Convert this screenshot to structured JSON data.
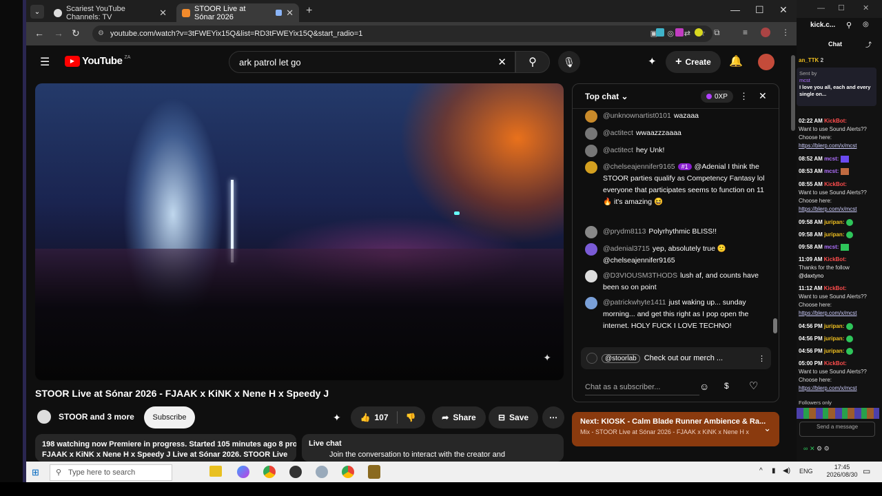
{
  "browser": {
    "tabs": [
      {
        "title": "Scariest YouTube Channels: TV",
        "favicon_color": "#e0e0e0"
      },
      {
        "title": "STOOR Live at Sónar 2026",
        "favicon_color": "#f28b2c"
      }
    ],
    "url": "youtube.com/watch?v=3tFWEYix15Q&list=RD3tFWEYix15Q&start_radio=1"
  },
  "youtube": {
    "logo": "YouTube",
    "country": "ZA",
    "search_value": "ark patrol let go",
    "create_label": "Create"
  },
  "video": {
    "title": "STOOR Live at Sónar 2026 - FJAAK x KiNK x Nene H x Speedy J",
    "channel": "STOOR and 3 more",
    "subscribe_label": "Subscribe",
    "likes": "107",
    "share_label": "Share",
    "save_label": "Save",
    "desc_line1": "198 watching now  Premiere in progress. Started 105 minutes ago  8 prod",
    "desc_line2": "FJAAK x KiNK x Nene H x Speedy J Live at Sónar 2026. STOOR Live",
    "livechat_label": "Live chat",
    "livechat_sub": "Join the conversation to interact with the creator and"
  },
  "chat": {
    "header": "Top chat",
    "xp_badge": "0XP",
    "messages": [
      {
        "user": "@unknownartist0101",
        "text": "wazaaa",
        "color": "#c98a2a"
      },
      {
        "user": "@actitect",
        "text": "wwaazzzaaaa",
        "color": "#777"
      },
      {
        "user": "@actitect",
        "text": "hey Unk!",
        "color": "#777"
      },
      {
        "user": "@chelseajennifer9165",
        "badge": "#1",
        "text": "@Adenial I think the STOOR parties qualify as Competency Fantasy lol everyone that participates seems to function on 11 🔥 it's amazing 😆",
        "color": "#d4a020"
      },
      {
        "user": "@prydm8113",
        "text": "Polyrhythmic BLISS!!",
        "color": "#888"
      },
      {
        "user": "@adenial3715",
        "text": "yep, absolutely true 🙂 @chelseajennifer9165",
        "color": "#7a5bd6"
      },
      {
        "user": "@D3VIOUSM3THODS",
        "text": "lush af, and counts have been so on point",
        "color": "#ddd"
      },
      {
        "user": "@patrickwhyte1411",
        "text": "just waking up... sunday morning... and get this right as I pop open the internet. HOLY FUCK I LOVE TECHNO!",
        "color": "#7aa0d8"
      }
    ],
    "pinned_user": "@stoorlab",
    "pinned_text": "Check out our merch ...",
    "input_placeholder": "Chat as a subscriber..."
  },
  "next_card": {
    "title": "Next: KIOSK - Calm Blade Runner Ambience & Ra...",
    "subtitle": "Mix - STOOR Live at Sónar 2026 - FJAAK x KiNK x Nene H x"
  },
  "kick": {
    "tab_label": "kick.c...",
    "chat_label": "Chat",
    "pinned_user": "an_TTK",
    "pinned_count": "2",
    "sent_by": "Sent by",
    "sent_by_user": "mcst",
    "pinned_msg": "I love you all, each and every single on...",
    "lines": [
      {
        "time": "02:22 AM",
        "user": "KickBot:",
        "text": "Want to use Sound Alerts?? Choose here:",
        "link": "https://blerp.com/x/mcst",
        "ucolor": "#ff4d4d"
      },
      {
        "time": "08:52 AM",
        "user": "mcst:",
        "text": "",
        "link": "",
        "ucolor": "#b070ff"
      },
      {
        "time": "08:53 AM",
        "user": "mcst:",
        "text": "",
        "link": "",
        "ucolor": "#b070ff"
      },
      {
        "time": "08:55 AM",
        "user": "KickBot:",
        "text": "Want to use Sound Alerts?? Choose here:",
        "link": "https://blerp.com/x/mcst",
        "ucolor": "#ff4d4d"
      },
      {
        "time": "09:58 AM",
        "user": "juripan:",
        "text": "",
        "link": "",
        "ucolor": "#f0c020"
      },
      {
        "time": "09:58 AM",
        "user": "juripan:",
        "text": "",
        "link": "",
        "ucolor": "#f0c020"
      },
      {
        "time": "09:58 AM",
        "user": "mcst:",
        "text": "",
        "link": "",
        "ucolor": "#b070ff"
      },
      {
        "time": "11:09 AM",
        "user": "KickBot:",
        "text": "Thanks for the follow",
        "link": "@daxtyno",
        "ucolor": "#ff4d4d"
      },
      {
        "time": "11:12 AM",
        "user": "KickBot:",
        "text": "Want to use Sound Alerts?? Choose here:",
        "link": "https://blerp.com/x/mcst",
        "ucolor": "#ff4d4d"
      },
      {
        "time": "04:56 PM",
        "user": "juripan:",
        "text": "",
        "link": "",
        "ucolor": "#f0c020"
      },
      {
        "time": "04:56 PM",
        "user": "juripan:",
        "text": "",
        "link": "",
        "ucolor": "#f0c020"
      },
      {
        "time": "04:56 PM",
        "user": "juripan:",
        "text": "",
        "link": "",
        "ucolor": "#f0c020"
      },
      {
        "time": "05:00 PM",
        "user": "KickBot:",
        "text": "Want to use Sound Alerts?? Choose here:",
        "link": "https://blerp.com/x/mcst",
        "ucolor": "#ff4d4d"
      }
    ],
    "followers_only": "Followers only",
    "send_placeholder": "Send a message"
  },
  "taskbar": {
    "search_placeholder": "Type here to search",
    "lang": "ENG",
    "time": "17:45",
    "date": "2026/08/30"
  }
}
